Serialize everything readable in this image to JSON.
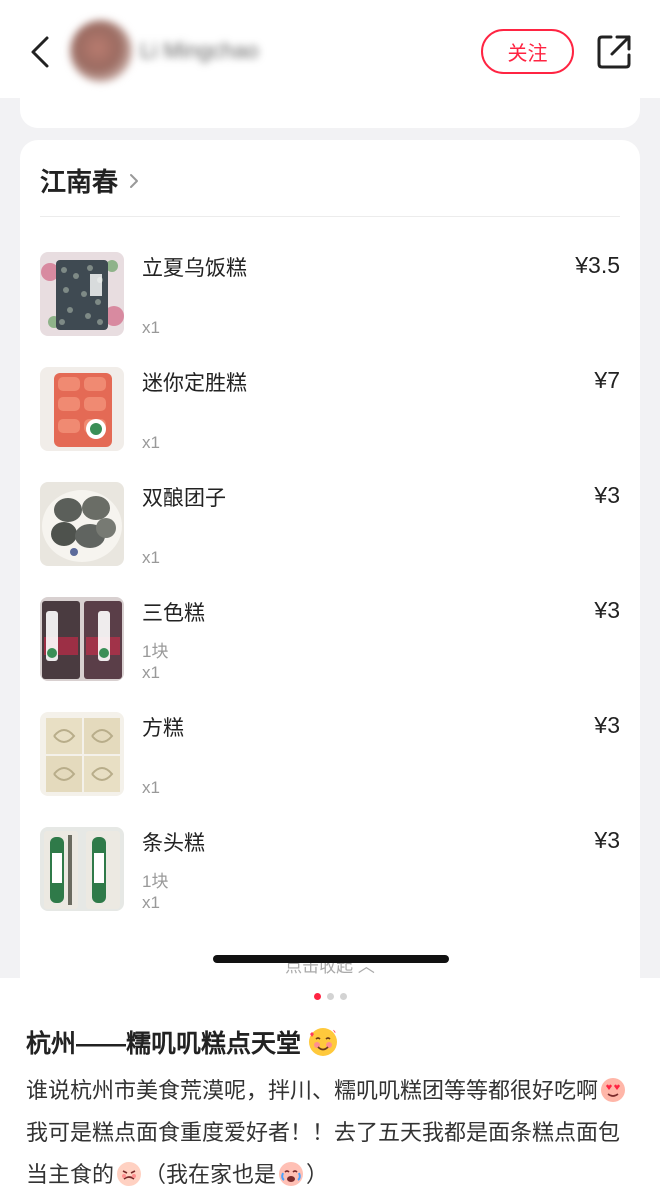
{
  "header": {
    "username": "Li Mingchao",
    "follow_label": "关注"
  },
  "store": {
    "name": "江南春",
    "items": [
      {
        "name": "立夏乌饭糕",
        "price": "¥3.5",
        "spec": "",
        "qty": "x1"
      },
      {
        "name": "迷你定胜糕",
        "price": "¥7",
        "spec": "",
        "qty": "x1"
      },
      {
        "name": "双酿团子",
        "price": "¥3",
        "spec": "",
        "qty": "x1"
      },
      {
        "name": "三色糕",
        "price": "¥3",
        "spec": "1块",
        "qty": "x1"
      },
      {
        "name": "方糕",
        "price": "¥3",
        "spec": "",
        "qty": "x1"
      },
      {
        "name": "条头糕",
        "price": "¥3",
        "spec": "1块",
        "qty": "x1"
      }
    ],
    "collapse_label": "点击收起 ︿"
  },
  "post": {
    "title": "杭州——糯叽叽糕点天堂",
    "body_part1": "谁说杭州市美食荒漠呢，拌川、糯叽叽糕团等等都很好吃啊",
    "body_part2": "我可是糕点面食重度爱好者！！去了五天我都是面条糕点面包当主食的",
    "body_part3": "（我在家也是",
    "body_part4": "）",
    "carousel_total": 3,
    "carousel_active": 1
  },
  "colors": {
    "accent": "#ff2442"
  }
}
